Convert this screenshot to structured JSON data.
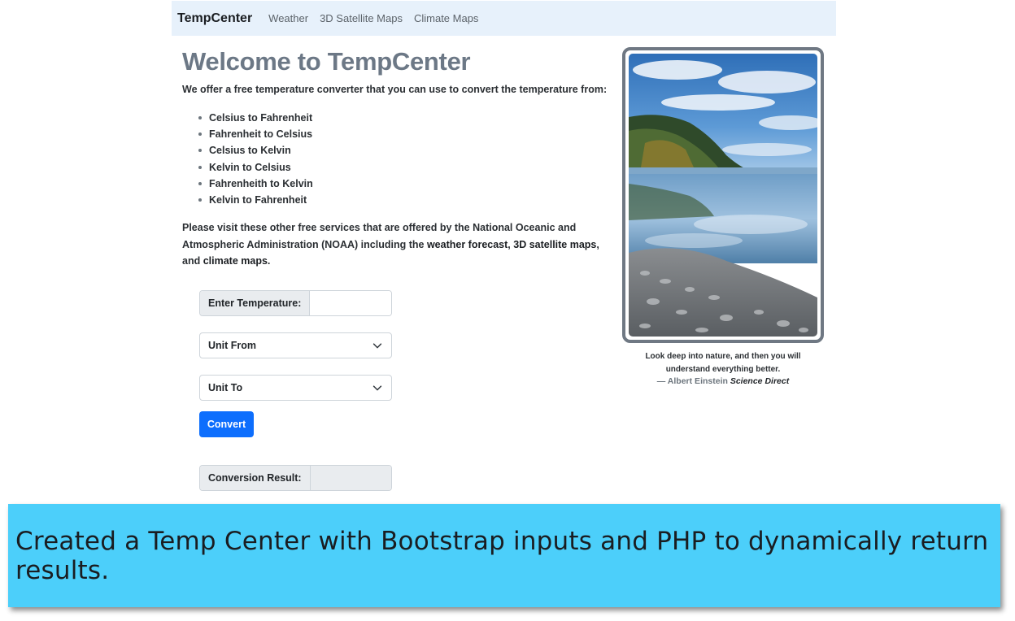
{
  "navbar": {
    "brand": "TempCenter",
    "links": [
      "Weather",
      "3D Satellite Maps",
      "Climate Maps"
    ]
  },
  "main": {
    "title": "Welcome to TempCenter",
    "intro": "We offer a free temperature converter that you can use to convert the temperature from:",
    "conversions": [
      "Celsius to Fahrenheit",
      "Fahrenheit to Celsius",
      "Celsius to Kelvin",
      "Kelvin to Celsius",
      "Fahrenheith to Kelvin",
      "Kelvin to Fahrenheit"
    ],
    "paragraph": {
      "prefix": "Please visit these other free services that are offered by the National Oceanic and Atmospheric Administration (NOAA) including the ",
      "link_weather": "weather forecast",
      "sep1": ", ",
      "link_satellite": "3D satellite maps",
      "sep2": ", and ",
      "link_climate": "climate maps",
      "suffix": "."
    }
  },
  "form": {
    "temperature_label": "Enter Temperature:",
    "temperature_value": "",
    "unit_from": "Unit From",
    "unit_to": "Unit To",
    "convert_label": "Convert",
    "result_label": "Conversion Result:",
    "result_value": ""
  },
  "sidebar": {
    "quote": "Look deep into nature, and then you will understand everything better.",
    "author": "— Albert Einstein",
    "source": "Science Direct"
  },
  "banner": {
    "caption": "Created a Temp Center with Bootstrap inputs and PHP to dynamically return results.",
    "background": "#4ccffa"
  },
  "colors": {
    "navbar_bg": "#e7f1fb",
    "title": "#6c7886",
    "primary_button": "#0d6efd"
  }
}
